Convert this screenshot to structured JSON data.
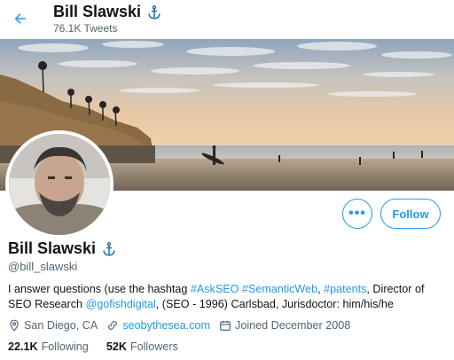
{
  "header": {
    "name": "Bill Slawski",
    "tweet_count": "76.1K Tweets"
  },
  "actions": {
    "more_label": "•••",
    "follow_label": "Follow"
  },
  "profile": {
    "name": "Bill Slawski",
    "handle": "@bill_slawski",
    "bio": {
      "t1": "I answer questions (use the hashtag ",
      "tag1": "#AskSEO",
      "t2": " ",
      "tag2": "#SemanticWeb",
      "t3": ", ",
      "tag3": "#patents",
      "t4": ", Director of SEO Research ",
      "mention": "@gofishdigital",
      "t5": ",  (SEO - 1996) Carlsbad, Jurisdoctor: him/his/he"
    },
    "location": "San Diego, CA",
    "website": "seobythesea.com",
    "joined": "Joined December 2008",
    "following_count": "22.1K",
    "following_label": "Following",
    "followers_count": "52K",
    "followers_label": "Followers"
  },
  "icons": {
    "back": "back-arrow-icon",
    "anchor": "anchor-icon",
    "location": "location-pin-icon",
    "link": "link-icon",
    "calendar": "calendar-icon"
  },
  "colors": {
    "accent": "#1d9bf0",
    "text": "#0f1419",
    "secondary": "#536471"
  }
}
